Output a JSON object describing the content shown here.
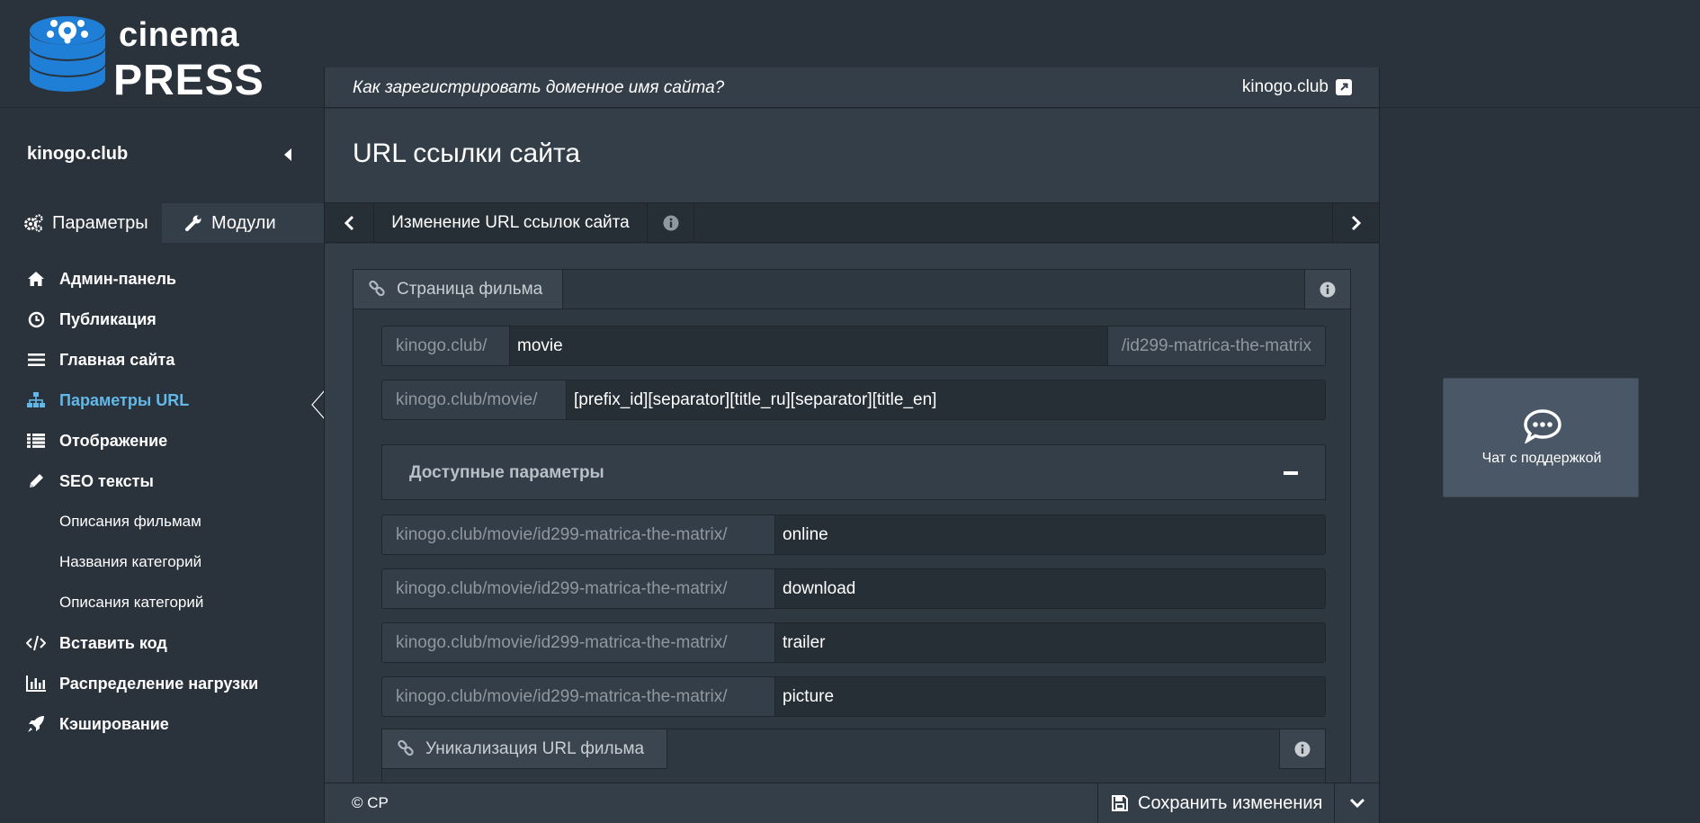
{
  "logo": {
    "word1": "cinema",
    "word2": "PRESS"
  },
  "sidebar": {
    "site_name": "kinogo.club",
    "tabs": [
      {
        "label": "Параметры",
        "icon": "gears-icon",
        "active": true
      },
      {
        "label": "Модули",
        "icon": "wrench-icon",
        "active": false
      }
    ],
    "menu": [
      {
        "label": "Админ-панель",
        "icon": "home-icon"
      },
      {
        "label": "Публикация",
        "icon": "clock-icon"
      },
      {
        "label": "Главная сайта",
        "icon": "list-icon"
      },
      {
        "label": "Параметры URL",
        "icon": "sitemap-icon",
        "active": true
      },
      {
        "label": "Отображение",
        "icon": "table-list-icon"
      },
      {
        "label": "SEO тексты",
        "icon": "pencil-icon"
      },
      {
        "label": "Описания фильмам",
        "sub": true
      },
      {
        "label": "Названия категорий",
        "sub": true
      },
      {
        "label": "Описания категорий",
        "sub": true
      },
      {
        "label": "Вставить код",
        "icon": "code-icon"
      },
      {
        "label": "Распределение нагрузки",
        "icon": "bar-chart-icon"
      },
      {
        "label": "Кэширование",
        "icon": "rocket-icon"
      }
    ]
  },
  "main": {
    "help_link": "Как зарегистрировать доменное имя сайта?",
    "domain_link": "kinogo.club",
    "title": "URL ссылки сайта",
    "breadcrumb": "Изменение URL ссылок сайта",
    "panel_title": "Страница фильма",
    "fields": {
      "movie_prefix": {
        "addon": "kinogo.club/",
        "value": "movie",
        "suffix": "/id299-matrica-the-matrix"
      },
      "movie_pattern": {
        "addon": "kinogo.club/movie/",
        "value": "[prefix_id][separator][title_ru][separator][title_en]"
      }
    },
    "available_params": {
      "title": "Доступные параметры"
    },
    "subpages": [
      {
        "addon": "kinogo.club/movie/id299-matrica-the-matrix/",
        "value": "online"
      },
      {
        "addon": "kinogo.club/movie/id299-matrica-the-matrix/",
        "value": "download"
      },
      {
        "addon": "kinogo.club/movie/id299-matrica-the-matrix/",
        "value": "trailer"
      },
      {
        "addon": "kinogo.club/movie/id299-matrica-the-matrix/",
        "value": "picture"
      }
    ],
    "subpanel_title": "Уникализация URL фильма",
    "footer": {
      "copyright": "© CP",
      "save_label": "Сохранить изменения"
    }
  },
  "chat": {
    "label": "Чат с поддержкой"
  },
  "colors": {
    "background": "#2a323b",
    "panel": "#343e48",
    "input": "#262e36",
    "accent": "#62b8e8",
    "logo_blue": "#1f7fd6"
  }
}
